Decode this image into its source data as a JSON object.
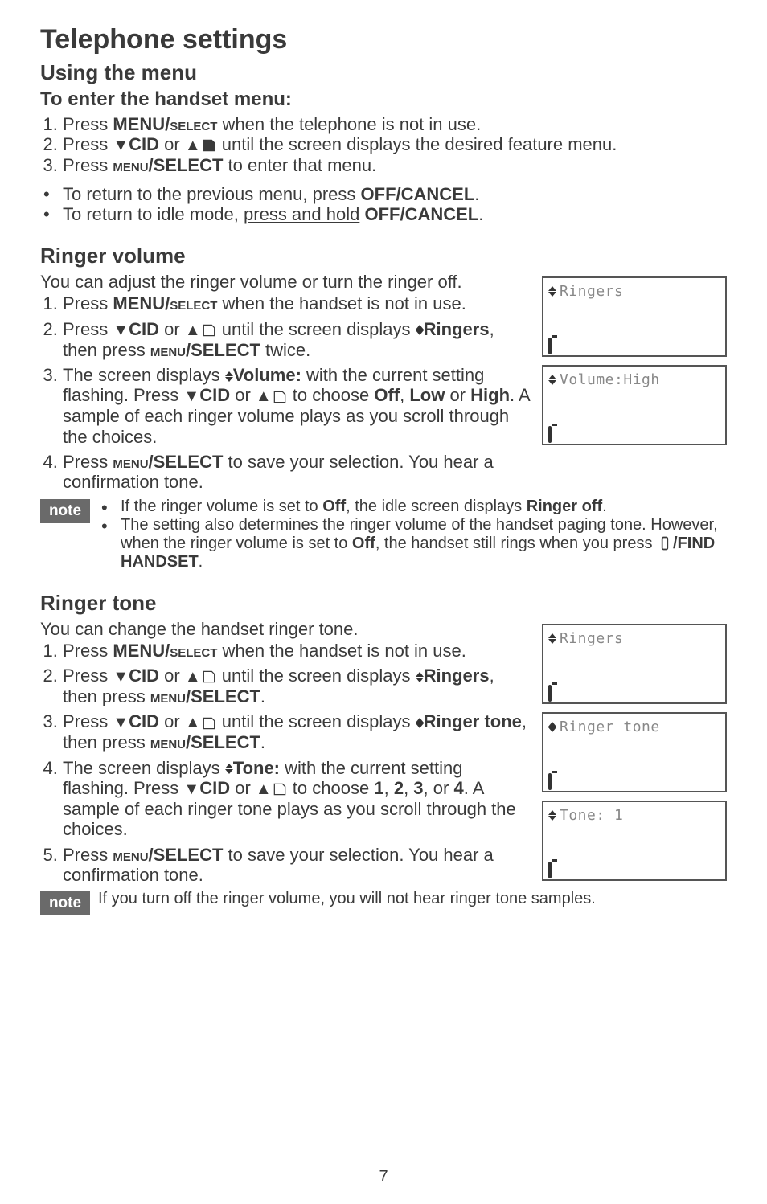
{
  "h1": "Telephone settings",
  "section_menu": {
    "h2": "Using the menu",
    "h3": "To enter the handset menu",
    "steps": [
      {
        "pre": "Press ",
        "bold1": "MENU/",
        "sc1": "select",
        "post": " when the telephone is not in use."
      },
      {
        "pre": "Press ",
        "cid": "CID",
        "or": " or ",
        "post": " until the screen displays the desired feature menu."
      },
      {
        "pre": "Press ",
        "sc1": "menu",
        "bold1": "/SELECT",
        "post": " to enter that menu."
      }
    ],
    "returns": [
      {
        "pre": "To return to the previous menu, press ",
        "bold": "OFF/CANCEL",
        "post": "."
      },
      {
        "pre": "To return to idle mode, ",
        "underline": "press and hold",
        "sp": " ",
        "bold": "OFF/CANCEL",
        "post": "."
      }
    ]
  },
  "section_volume": {
    "h2": "Ringer volume",
    "intro": "You can adjust the ringer volume or turn the ringer off.",
    "step1": {
      "pre": "Press ",
      "bold1": "MENU/",
      "sc1": "select",
      "post": " when the handset is not in use."
    },
    "step2": {
      "pre": "Press ",
      "cid": "CID",
      "or": " or ",
      "mid": " until the screen displays ",
      "bold2": "Ringers",
      "then": ", then press ",
      "sc1": "menu",
      "bold1": "/SELECT",
      "post": " twice."
    },
    "step3": {
      "pre": "The screen displays ",
      "boldv": "Volume:",
      "mid": " with the current setting flashing. Press ",
      "cid": "CID",
      "or": " or ",
      "mid2": " to choose ",
      "off": "Off",
      "comma": ", ",
      "low": "Low",
      "or2": " or ",
      "high": "High",
      "post": ". A sample of each ringer volume plays as you scroll through the choices."
    },
    "step4": {
      "pre": "Press ",
      "sc1": "menu",
      "bold1": "/SELECT",
      "post": " to save your selection. You hear a confirmation tone."
    },
    "lcd1": "Ringers",
    "lcd2": "Volume:High",
    "note_label": "note",
    "note_bullets": [
      {
        "pre": "If the ringer volume is set to ",
        "off": "Off",
        "mid": ", the idle screen displays ",
        "ro": "Ringer off",
        "post": "."
      },
      {
        "pre": "The setting also determines the ringer volume of the handset paging tone. However, when the ringer volume is set to ",
        "off": "Off",
        "mid": ", the handset still rings when you press ",
        "fh": "/FIND HANDSET",
        "post": "."
      }
    ]
  },
  "section_tone": {
    "h2": "Ringer tone",
    "intro": "You can change the handset ringer tone.",
    "step1": {
      "pre": "Press ",
      "bold1": "MENU/",
      "sc1": "select",
      "post": " when the handset is not in use."
    },
    "step2": {
      "pre": "Press ",
      "cid": "CID",
      "or": " or ",
      "mid": " until the screen displays ",
      "bold2": "Ringers",
      "then": ", then press ",
      "sc1": "menu",
      "bold1": "/SELECT",
      "post": "."
    },
    "step3": {
      "pre": "Press ",
      "cid": "CID",
      "or": " or ",
      "mid": " until the screen displays ",
      "bold2": "Ringer tone",
      "then": ", then press ",
      "sc1": "menu",
      "bold1": "/SELECT",
      "post": "."
    },
    "step4": {
      "pre": "The screen displays ",
      "boldv": "Tone:",
      "mid": " with the current setting flashing. Press ",
      "cid": "CID",
      "or": " or ",
      "mid2": " to choose ",
      "n1": "1",
      "c1": ", ",
      "n2": "2",
      "c2": ", ",
      "n3": "3",
      "c3": ", or ",
      "n4": "4",
      "post": ". A sample of each ringer tone plays as you scroll through the choices."
    },
    "step5": {
      "pre": "Press ",
      "sc1": "menu",
      "bold1": "/SELECT",
      "post": " to save your selection. You hear a confirmation tone."
    },
    "lcd1": "Ringers",
    "lcd2": "Ringer tone",
    "lcd3": "Tone: 1",
    "note_label": "note",
    "note_text": "If you turn off the ringer volume, you will not hear ringer tone samples."
  },
  "page_number": "7"
}
